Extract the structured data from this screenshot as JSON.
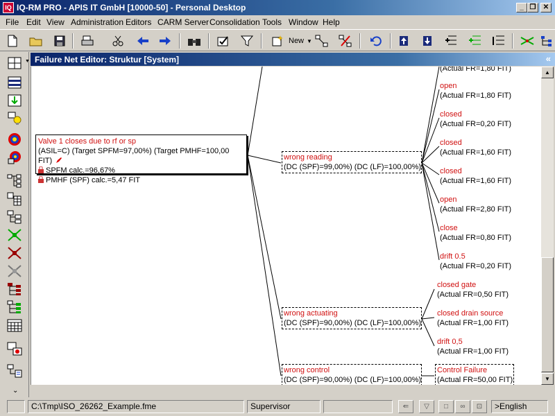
{
  "window": {
    "title": "IQ-RM PRO - APIS IT GmbH [10000-50] - Personal Desktop",
    "minimize": "_",
    "restore": "❐",
    "close": "✕"
  },
  "menu": [
    "File",
    "Edit",
    "View",
    "Administration",
    "Editors",
    "CARM Server",
    "Consolidation",
    "Tools",
    "Window",
    "Help"
  ],
  "toolbar": {
    "new_label": "New"
  },
  "editor": {
    "title": "Failure Net Editor: Struktur [System]",
    "collapse_glyph": "«"
  },
  "root": {
    "title": "Valve 1 closes due to rf or sp",
    "targets": "(ASIL=C) (Target SPFM=97,00%) (Target PMHF=100,00 FIT)",
    "spfm": "SPFM calc.=96,67%",
    "pmhf": "PMHF (SPF) calc.=5,47 FIT"
  },
  "mid_nodes": [
    {
      "label": "wrong reading",
      "detail": "(DC (SPF)=99,00%) (DC (LF)=100,00%)"
    },
    {
      "label": "wrong actuating",
      "detail": "(DC (SPF)=90,00%) (DC (LF)=100,00%)"
    },
    {
      "label": "wrong control",
      "detail": "(DC (SPF)=90,00%) (DC (LF)=100,00%)"
    }
  ],
  "reading_children": [
    {
      "label": "",
      "fr": "(Actual FR=1,80 FIT)"
    },
    {
      "label": "open",
      "fr": "(Actual FR=1,80 FIT)"
    },
    {
      "label": "closed",
      "fr": "(Actual FR=0,20 FIT)"
    },
    {
      "label": "closed",
      "fr": "(Actual FR=1,60 FIT)"
    },
    {
      "label": "closed",
      "fr": "(Actual FR=1,60 FIT)"
    },
    {
      "label": "open",
      "fr": "(Actual FR=2,80 FIT)"
    },
    {
      "label": "close",
      "fr": "(Actual FR=0,80 FIT)"
    },
    {
      "label": "drift 0.5",
      "fr": "(Actual FR=0,20 FIT)"
    }
  ],
  "actuating_children": [
    {
      "label": "closed gate",
      "fr": "(Actual FR=0,50 FIT)"
    },
    {
      "label": "closed drain source",
      "fr": "(Actual FR=1,00 FIT)"
    },
    {
      "label": "drift 0,5",
      "fr": "(Actual FR=1,00 FIT)"
    }
  ],
  "control_children": [
    {
      "label": "Control Failure",
      "fr": "(Actual FR=50,00 FIT)"
    }
  ],
  "status": {
    "path": "C:\\Tmp\\ISO_26262_Example.fme",
    "user": "Supervisor",
    "language": ">English"
  }
}
